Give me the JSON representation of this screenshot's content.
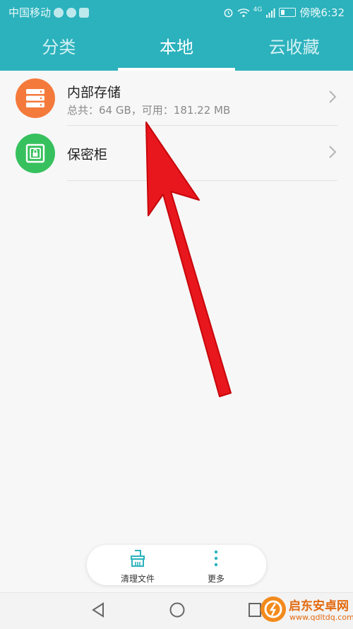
{
  "status_bar": {
    "carrier": "中国移动",
    "network": "4G",
    "time_text": "傍晚6:32"
  },
  "tabs": [
    {
      "label": "分类",
      "active": false
    },
    {
      "label": "本地",
      "active": true
    },
    {
      "label": "云收藏",
      "active": false
    }
  ],
  "items": [
    {
      "title": "内部存储",
      "subtitle": "总共：64 GB，可用：181.22 MB",
      "icon": "storage-icon",
      "color": "#f47a3b"
    },
    {
      "title": "保密柜",
      "subtitle": "",
      "icon": "safe-icon",
      "color": "#37c15e"
    }
  ],
  "bottom_actions": [
    {
      "label": "清理文件",
      "icon": "broom-icon"
    },
    {
      "label": "更多",
      "icon": "more-vertical-icon"
    }
  ],
  "watermark": {
    "name": "启东安卓网",
    "url": "www.qdltdq.com"
  },
  "colors": {
    "header": "#2bb2bd",
    "annotation_arrow": "#e8171d"
  }
}
